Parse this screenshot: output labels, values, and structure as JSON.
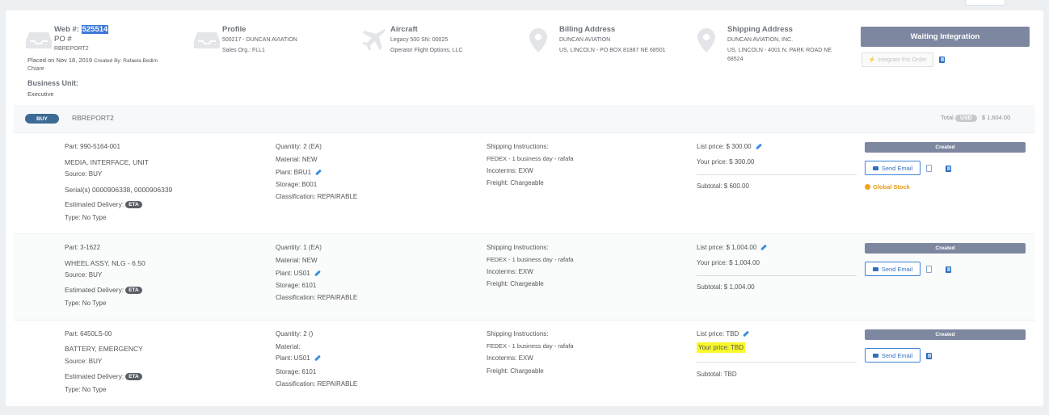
{
  "header": {
    "web_label": "Web #:",
    "web_number": "525514",
    "po_label": "PO #",
    "po_value": "RBREPORT2",
    "placed_on": "Placed on Nov 18, 2019",
    "created_by": "Created By: Rafaela Bedim",
    "created_by_cont": "Chiare",
    "business_unit_label": "Business Unit:",
    "business_unit_value": "Executive",
    "profile_title": "Profile",
    "profile_line1": "500217 - DUNCAN AVIATION",
    "profile_line2": "Sales Org.: FLL1",
    "aircraft_title": "Aircraft",
    "aircraft_line1": "Legacy 500 SN: 00025",
    "aircraft_line2": "Operator Flight Options, LLC",
    "billing_title": "Billing Address",
    "billing_line1": "DUNCAN AVIATION",
    "billing_line2": "US, LINCOLN - PO BOX 81887 NE 68501",
    "shipping_title": "Shipping Address",
    "shipping_line1": "DUNCAN AVIATION, INC.",
    "shipping_line2": "US, LINCOLN - 4001 N. PARK ROAD NE",
    "shipping_line3": "68524",
    "status_button": "Waiting Integration",
    "integrate_button": "Integrate this Order"
  },
  "order": {
    "type_badge": "BUY",
    "name": "RBREPORT2",
    "total_label": "Total",
    "currency": "USD",
    "total_value": "$ 1,604.00"
  },
  "items": [
    {
      "part": "Part: 990-5164-001",
      "description": "MEDIA, INTERFACE, UNIT",
      "source": "Source: BUY",
      "serials": "Serial(s) 0000906338, 0000906339",
      "est_delivery": "Estimated Delivery:",
      "eta": "ETA",
      "type": "Type: No Type",
      "quantity": "Quantity: 2 (EA)",
      "material": "Material: NEW",
      "plant": "Plant: BRU1",
      "storage": "Storage: B001",
      "classification": "Classification: REPAIRABLE",
      "ship_instr_label": "Shipping Instructions:",
      "ship_instr_value": "FEDEX - 1 business day - rafafa",
      "incoterms": "Incoterms: EXW",
      "freight": "Freight: Chargeable",
      "list_price": "List price: $ 300.00",
      "your_price": "Your price: $ 300.00",
      "subtotal": "Subtotal: $ 600.00",
      "status": "Created",
      "send_email": "Send Email",
      "global_stock": "Global Stock"
    },
    {
      "part": "Part: 3-1622",
      "description": "WHEEL ASSY, NLG - 6.50",
      "source": "Source: BUY",
      "est_delivery": "Estimated Delivery:",
      "eta": "ETA",
      "type": "Type: No Type",
      "quantity": "Quantity: 1 (EA)",
      "material": "Material: NEW",
      "plant": "Plant: US01",
      "storage": "Storage: 6101",
      "classification": "Classification: REPAIRABLE",
      "ship_instr_label": "Shipping Instructions:",
      "ship_instr_value": "FEDEX - 1 business day - rafafa",
      "incoterms": "Incoterms: EXW",
      "freight": "Freight: Chargeable",
      "list_price": "List price: $ 1,004.00",
      "your_price": "Your price: $ 1,004.00",
      "subtotal": "Subtotal: $ 1,004.00",
      "status": "Created",
      "send_email": "Send Email"
    },
    {
      "part": "Part: 6450LS-00",
      "description": "BATTERY, EMERGENCY",
      "source": "Source: BUY",
      "est_delivery": "Estimated Delivery:",
      "eta": "ETA",
      "type": "Type: No Type",
      "quantity": "Quantity: 2 ()",
      "material": "Material:",
      "plant": "Plant: US01",
      "storage": "Storage: 6101",
      "classification": "Classification: REPAIRABLE",
      "ship_instr_label": "Shipping Instructions:",
      "ship_instr_value": "FEDEX - 1 business day - rafafa",
      "incoterms": "Incoterms: EXW",
      "freight": "Freight: Chargeable",
      "list_price": "List price: TBD",
      "your_price": "Your price: TBD",
      "subtotal": "Subtotal: TBD",
      "status": "Created",
      "send_email": "Send Email"
    }
  ],
  "colors": {
    "status_gray": "#7d879f",
    "buy_badge": "#3d6b96",
    "link_blue": "#2f6fc0",
    "highlight": "#f8f82a",
    "global_stock": "#e69a13"
  }
}
